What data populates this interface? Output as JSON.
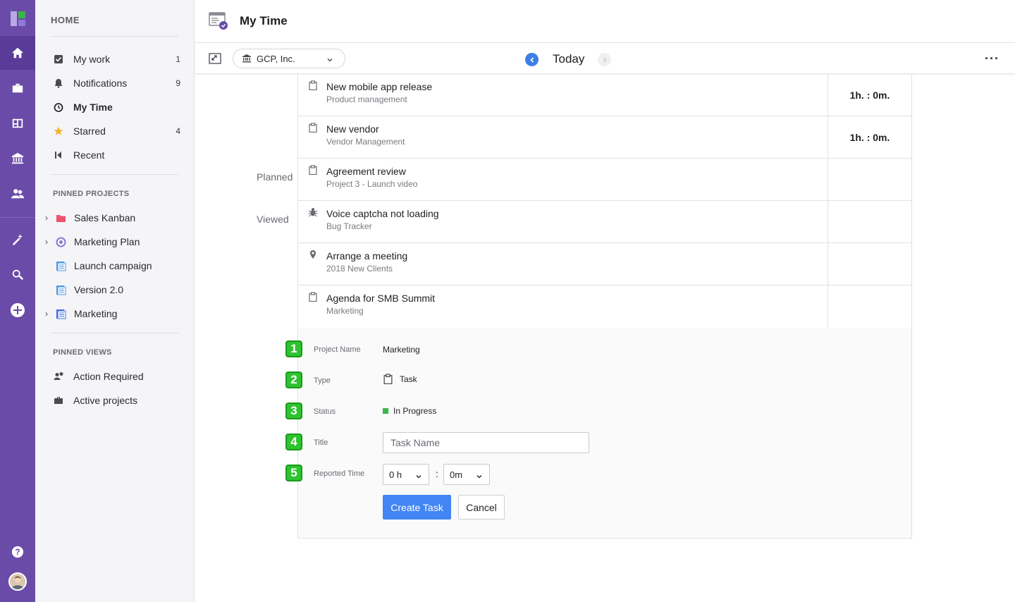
{
  "sidebar": {
    "home_label": "HOME",
    "items": [
      {
        "label": "My work",
        "count": "1"
      },
      {
        "label": "Notifications",
        "count": "9"
      },
      {
        "label": "My Time",
        "count": ""
      },
      {
        "label": "Starred",
        "count": "4"
      },
      {
        "label": "Recent",
        "count": ""
      }
    ],
    "pinned_projects_label": "PINNED PROJECTS",
    "pinned_projects": [
      {
        "label": "Sales Kanban",
        "expandable": true
      },
      {
        "label": "Marketing Plan",
        "expandable": true
      },
      {
        "label": "Launch campaign",
        "expandable": false
      },
      {
        "label": "Version 2.0",
        "expandable": false
      },
      {
        "label": "Marketing",
        "expandable": true
      }
    ],
    "pinned_views_label": "PINNED VIEWS",
    "pinned_views": [
      {
        "label": "Action Required"
      },
      {
        "label": "Active projects"
      }
    ]
  },
  "header": {
    "title": "My Time"
  },
  "toolbar": {
    "org": "GCP, Inc.",
    "date_label": "Today",
    "more": "···"
  },
  "groups": {
    "planned": "Planned",
    "viewed": "Viewed"
  },
  "tracked_rows": [
    {
      "title": "New mobile app release",
      "project": "Product management",
      "time": "1h. : 0m.",
      "icon": "clipboard-icon"
    },
    {
      "title": "New vendor",
      "project": "Vendor Management",
      "time": "1h. : 0m.",
      "icon": "clipboard-icon"
    }
  ],
  "other_rows": [
    {
      "title": "Agreement review",
      "project": "Project 3 - Launch video",
      "time": "",
      "icon": "clipboard-icon"
    },
    {
      "title": "Voice captcha not loading",
      "project": "Bug Tracker",
      "time": "",
      "icon": "bug-icon"
    },
    {
      "title": "Arrange a meeting",
      "project": "2018 New Clients",
      "time": "",
      "icon": "pin-icon"
    },
    {
      "title": "Agenda for SMB Summit",
      "project": "Marketing",
      "time": "",
      "icon": "clipboard-icon"
    }
  ],
  "form": {
    "badges": [
      "1",
      "2",
      "3",
      "4",
      "5"
    ],
    "project_name_label": "Project Name",
    "project_name_value": "Marketing",
    "type_label": "Type",
    "type_value": "Task",
    "status_label": "Status",
    "status_value": "In Progress",
    "status_color": "#3cb54a",
    "title_label": "Title",
    "title_placeholder": "Task Name",
    "reported_time_label": "Reported Time",
    "hours_value": "0 h",
    "colon": ":",
    "minutes_value": "0m",
    "create_label": "Create Task",
    "cancel_label": "Cancel"
  },
  "colors": {
    "rail": "#6a4ba8",
    "primary": "#4285f4",
    "badge": "#2fc32f"
  }
}
